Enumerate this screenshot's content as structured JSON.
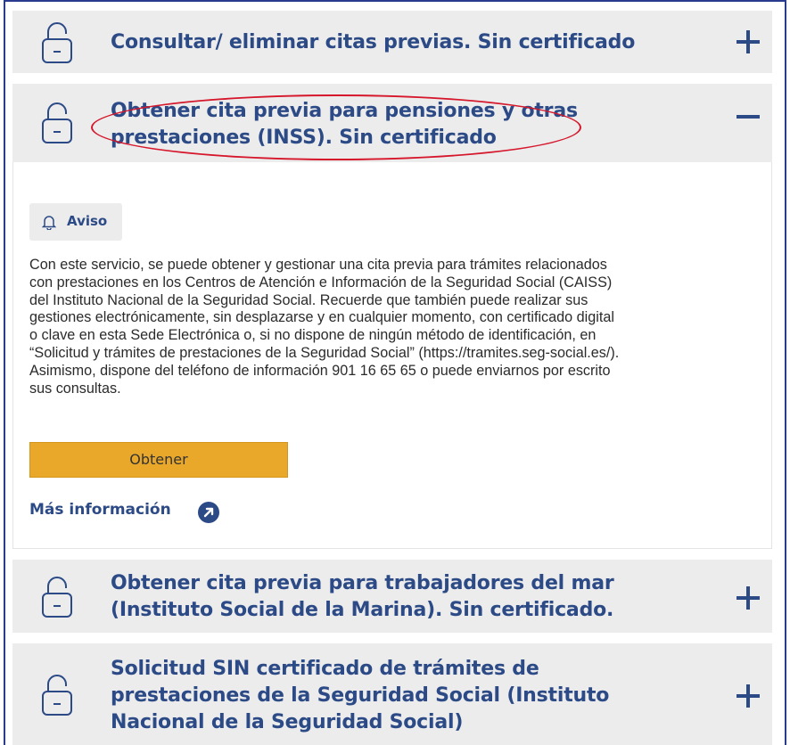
{
  "accordion": {
    "items": [
      {
        "title_lines": [
          "Consultar/ eliminar citas previas. Sin certificado"
        ],
        "expanded": false,
        "toggle": "+"
      },
      {
        "title_lines": [
          "Obtener cita previa para pensiones y otras",
          "prestaciones (INSS). Sin certificado"
        ],
        "expanded": true,
        "toggle": "−"
      },
      {
        "title_lines": [
          "Obtener cita previa para trabajadores del mar",
          "(Instituto Social de la Marina). Sin certificado."
        ],
        "expanded": false,
        "toggle": "+"
      },
      {
        "title_lines": [
          "Solicitud SIN certificado de trámites de",
          "prestaciones de la Seguridad Social (Instituto",
          "Nacional de la Seguridad Social)"
        ],
        "expanded": false,
        "toggle": "+"
      }
    ]
  },
  "panel": {
    "notice_label": "Aviso",
    "body_lines": [
      "Con este servicio, se puede obtener y gestionar una cita previa para trámites relacionados",
      "con prestaciones en los Centros de Atención e Información de la Seguridad Social (CAISS)",
      "del Instituto Nacional de la Seguridad Social. Recuerde que también puede realizar sus",
      "gestiones electrónicamente, sin desplazarse y en cualquier momento, con certificado digital",
      "o clave en esta Sede Electrónica o, si no dispone de ningún método de identificación, en",
      "“Solicitud y trámites de prestaciones de la Seguridad Social” (https://tramites.seg-social.es/).",
      "Asimismo, dispone del teléfono de información 901 16 65 65 o puede enviarnos por escrito",
      "sus consultas."
    ],
    "obtain_button": "Obtener",
    "more_info_link": "Más información"
  },
  "icons": {
    "lock": "unlock-icon",
    "expand": "plus-icon",
    "collapse": "minus-icon",
    "bell": "bell-icon",
    "external": "external-link-icon"
  },
  "colors": {
    "title_blue": "#2c4a86",
    "header_bg": "#ececec",
    "button_bg": "#e9a82a",
    "highlight_red": "#d6162b",
    "frame_border": "#2a3b8f"
  }
}
